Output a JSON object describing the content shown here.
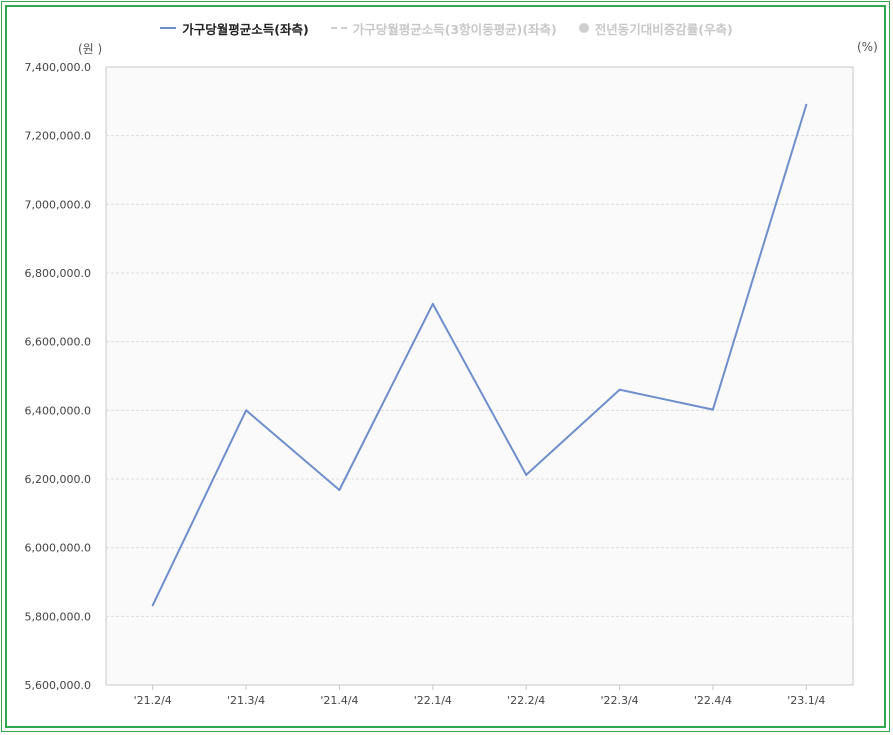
{
  "legend": {
    "series1": "가구당월평균소득(좌측)",
    "series2": "가구당월평균소득(3항이동평균)(좌측)",
    "series3": "전년동기대비증감률(우측)"
  },
  "axis_units": {
    "left": "(원 )",
    "right": "(%)"
  },
  "colors": {
    "line": "#6f8fcc",
    "frame": "#2fa84f",
    "plot_bg": "#fafafa",
    "grid": "#dddddd"
  },
  "chart_data": {
    "type": "line",
    "categories": [
      "'21.2/4",
      "'21.3/4",
      "'21.4/4",
      "'22.1/4",
      "'22.2/4",
      "'22.3/4",
      "'22.4/4",
      "'23.1/4"
    ],
    "series": [
      {
        "name": "가구당월평균소득(좌측)",
        "values": [
          5832000,
          6400000,
          6168000,
          6710000,
          6212000,
          6460000,
          6402000,
          7290000
        ]
      }
    ],
    "yticks": [
      "7,400,000.0",
      "7,200,000.0",
      "7,000,000.0",
      "6,800,000.0",
      "6,600,000.0",
      "6,400,000.0",
      "6,200,000.0",
      "6,000,000.0",
      "5,800,000.0",
      "5,600,000.0"
    ],
    "ylim": [
      5600000,
      7400000
    ],
    "grid": true,
    "legend_position": "top-center"
  }
}
